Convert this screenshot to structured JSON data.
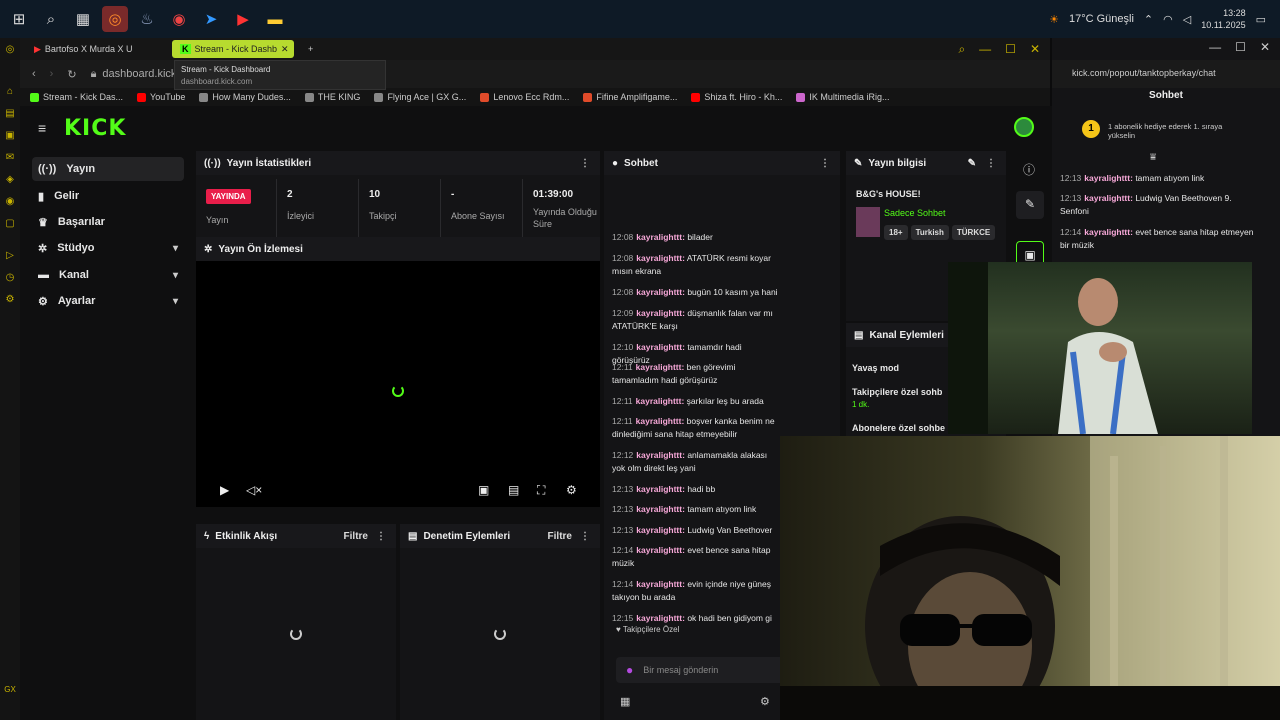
{
  "taskbar": {
    "weather": "17°C  Güneşli",
    "time": "13:28",
    "date": "10.11.2025"
  },
  "tabs": [
    {
      "label": "Bartofso X Murda X U"
    },
    {
      "label": "Stream - Kick Dashb"
    }
  ],
  "tooltip": {
    "title": "Stream - Kick Dashboard",
    "url": "dashboard.kick.com"
  },
  "address": {
    "url": "dashboard.kick.co"
  },
  "bookmarks": [
    {
      "label": "Stream - Kick Das...",
      "color": "#53fc18"
    },
    {
      "label": "YouTube",
      "color": "#ff0000"
    },
    {
      "label": "How Many Dudes...",
      "color": "#888888"
    },
    {
      "label": "THE KING",
      "color": "#888888"
    },
    {
      "label": "Flying Ace | GX G...",
      "color": "#888888"
    },
    {
      "label": "Lenovo Ecc Rdm...",
      "color": "#e04b2a"
    },
    {
      "label": "Fifine Amplifigame...",
      "color": "#e04b2a"
    },
    {
      "label": "Shiza ft. Hiro - Kh...",
      "color": "#ff0000"
    },
    {
      "label": "IK Multimedia iRig...",
      "color": "#cc66cc"
    }
  ],
  "nav": [
    {
      "label": "Yayın"
    },
    {
      "label": "Gelir"
    },
    {
      "label": "Başarılar"
    },
    {
      "label": "Stüdyo"
    },
    {
      "label": "Kanal"
    },
    {
      "label": "Ayarlar"
    }
  ],
  "stats": {
    "title": "Yayın İstatistikleri",
    "live_badge": "YAYINDA",
    "live_label": "Yayın",
    "viewers_value": "2",
    "viewers_label": "İzleyici",
    "followers_value": "10",
    "followers_label": "Takipçi",
    "subs_value": "-",
    "subs_label": "Abone Sayısı",
    "uptime_value": "01:39:00",
    "uptime_label": "Yayında Olduğu Süre"
  },
  "preview": {
    "title": "Yayın Ön İzlemesi"
  },
  "activity": {
    "title": "Etkinlik Akışı",
    "filter": "Filtre"
  },
  "moderation": {
    "title": "Denetim Eylemleri",
    "filter": "Filtre"
  },
  "chat": {
    "title": "Sohbet",
    "followers_only": "Takipçilere Özel",
    "placeholder": "Bir mesaj gönderin",
    "messages": [
      {
        "time": "12:08",
        "user": "kayralighttt:",
        "text": "bilader"
      },
      {
        "time": "12:08",
        "user": "kayralighttt:",
        "text": "ATATÜRK resmi koyar mısın ekrana"
      },
      {
        "time": "12:08",
        "user": "kayralighttt:",
        "text": "bugün 10 kasım ya hani"
      },
      {
        "time": "12:09",
        "user": "kayralighttt:",
        "text": "düşmanlık falan var mı ATATÜRK'E karşı"
      },
      {
        "time": "12:10",
        "user": "kayralighttt:",
        "text": "tamamdır hadi görüşürüz"
      },
      {
        "time": "12:11",
        "user": "kayralighttt:",
        "text": "ben görevimi tamamladım hadi görüşürüz"
      },
      {
        "time": "12:11",
        "user": "kayralighttt:",
        "text": "şarkılar leş bu arada"
      },
      {
        "time": "12:11",
        "user": "kayralighttt:",
        "text": "boşver kanka benim ne dinlediğimi sana hitap etmeyebilir"
      },
      {
        "time": "12:12",
        "user": "kayralighttt:",
        "text": "anlamamakla alakası yok olm direkt leş yani"
      },
      {
        "time": "12:13",
        "user": "kayralighttt:",
        "text": "hadi bb"
      },
      {
        "time": "12:13",
        "user": "kayralighttt:",
        "text": "tamam atıyom link"
      },
      {
        "time": "12:13",
        "user": "kayralighttt:",
        "text": "Ludwig Van Beethover"
      },
      {
        "time": "12:14",
        "user": "kayralighttt:",
        "text": "evet bence sana hitap müzik"
      },
      {
        "time": "12:14",
        "user": "kayralighttt:",
        "text": "evin içinde niye güneş takıyon bu arada"
      },
      {
        "time": "12:15",
        "user": "kayralighttt:",
        "text": "ok hadi ben gidiyom gi"
      }
    ]
  },
  "info": {
    "title": "Yayın bilgisi",
    "stream_title": "B&G's HOUSE!",
    "category": "Sadece Sohbet",
    "tags": [
      "18+",
      "Turkish",
      "TÜRKCE"
    ]
  },
  "channel_actions": {
    "title": "Kanal Eylemleri",
    "slow_mode": "Yavaş mod",
    "followers_chat": "Takipçilere özel sohb",
    "followers_chat_value": "1 dk.",
    "subs_chat": "Abonelere özel sohbe"
  },
  "popout": {
    "url": "kick.com/popout/tanktopberkay/chat",
    "title": "Sohbet",
    "gift_text": "1 abonelik hediye ederek 1. sıraya yükselin",
    "gift_rank": "1",
    "messages": [
      {
        "time": "12:13",
        "user": "kayralighttt:",
        "text": "tamam atıyom link"
      },
      {
        "time": "12:13",
        "user": "kayralighttt:",
        "text": "Ludwig Van Beethoven 9. Senfoni"
      },
      {
        "time": "12:14",
        "user": "kayralighttt:",
        "text": "evet bence sana hitap etmeyen bir müzik"
      }
    ]
  },
  "colors": {
    "kick_green": "#53fc18",
    "live_red": "#e91e4a",
    "username_pink": "#f7a8d8"
  }
}
